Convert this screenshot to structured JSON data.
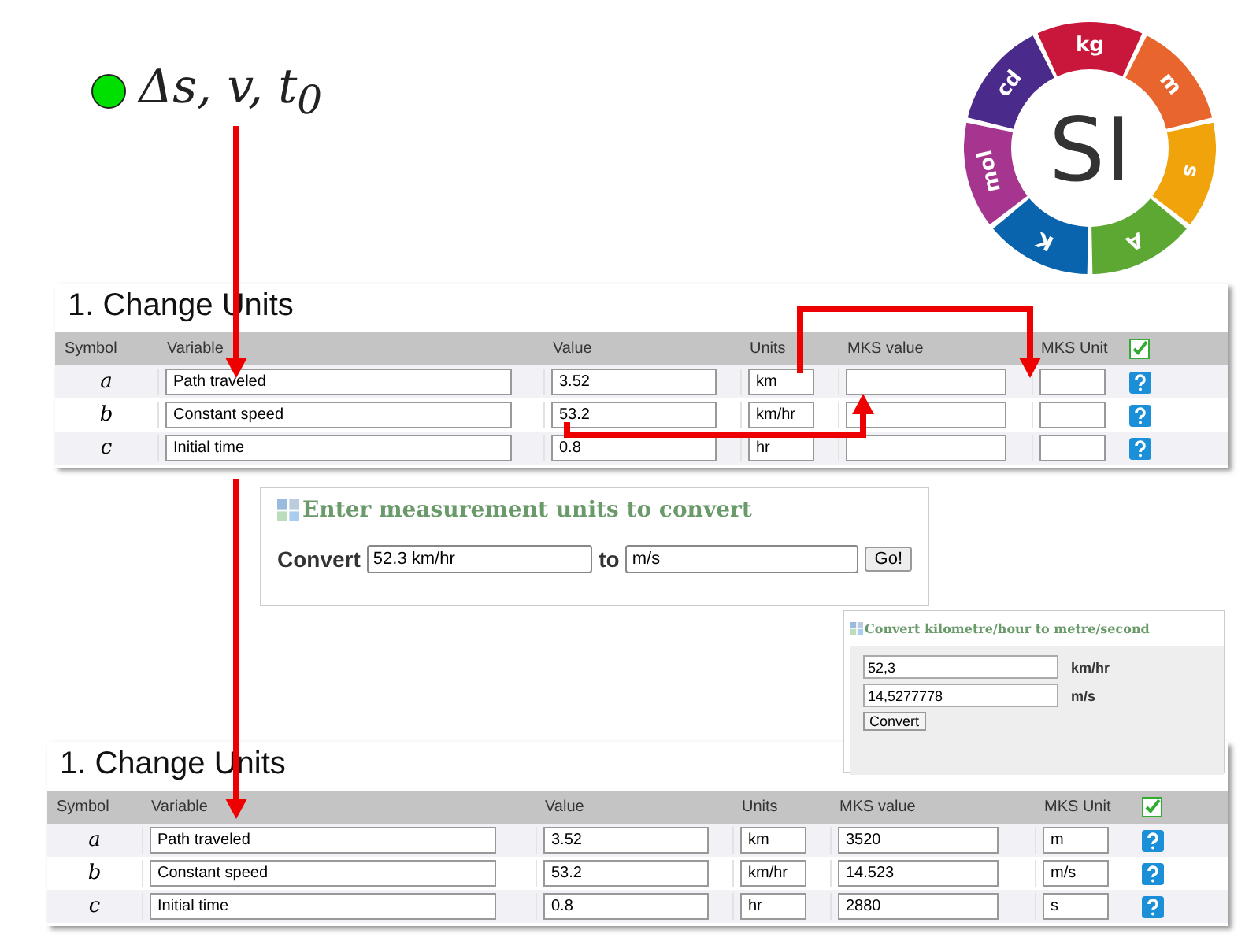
{
  "formula": {
    "text": "Δs, v, t$_{0}$"
  },
  "si_logo": {
    "center": "SI",
    "units": [
      {
        "label": "kg",
        "color": "#c8173a"
      },
      {
        "label": "m",
        "color": "#e8662e"
      },
      {
        "label": "s",
        "color": "#f0a30a"
      },
      {
        "label": "A",
        "color": "#5ca832"
      },
      {
        "label": "K",
        "color": "#0a64ad"
      },
      {
        "label": "mol",
        "color": "#a6358f"
      },
      {
        "label": "cd",
        "color": "#4a2a8a"
      }
    ]
  },
  "table_before": {
    "title": "1. Change Units",
    "columns": [
      "Symbol",
      "Variable",
      "Value",
      "Units",
      "MKS value",
      "MKS Unit"
    ],
    "rows": [
      {
        "symbol": "a",
        "variable": "Path traveled",
        "value": "3.52",
        "units": "km"
      },
      {
        "symbol": "b",
        "variable": "Constant speed",
        "value": "53.2",
        "units": "km/hr"
      },
      {
        "symbol": "c",
        "variable": "Initial time",
        "value": "0.8",
        "units": "hr"
      }
    ]
  },
  "converter": {
    "title": "Enter measurement units to convert",
    "label": "Convert",
    "from": "52.3 km/hr",
    "to_label": "to",
    "to": "m/s",
    "button": "Go!"
  },
  "result_box": {
    "title": "Convert kilometre/hour to metre/second",
    "fields": [
      {
        "value": "52,3",
        "unit": "km/hr"
      },
      {
        "value": "14,5277778",
        "unit": "m/s"
      }
    ],
    "button": "Convert"
  },
  "table_after": {
    "title": "1. Change Units",
    "columns": [
      "Symbol",
      "Variable",
      "Value",
      "Units",
      "MKS value",
      "MKS Unit"
    ],
    "rows": [
      {
        "symbol": "a",
        "variable": "Path traveled",
        "value": "3.52",
        "units": "km",
        "mks_value": "3520",
        "mks_unit": "m"
      },
      {
        "symbol": "b",
        "variable": "Constant speed",
        "value": "53.2",
        "units": "km/hr",
        "mks_value": "14.523",
        "mks_unit": "m/s"
      },
      {
        "symbol": "c",
        "variable": "Initial time",
        "value": "0.8",
        "units": "hr",
        "mks_value": "2880",
        "mks_unit": "s"
      }
    ]
  }
}
